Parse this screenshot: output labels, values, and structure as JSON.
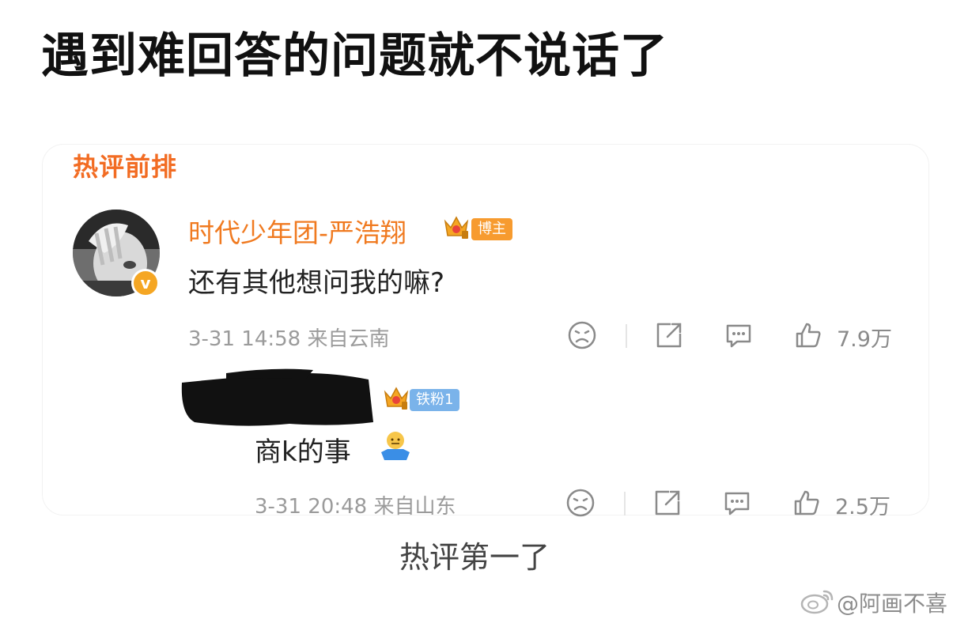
{
  "headline": "遇到难回答的问题就不说话了",
  "section_title": "热评前排",
  "comment": {
    "username": "时代少年团-严浩翔",
    "badge": "博主",
    "text": "还有其他想问我的嘛?",
    "timestamp": "3-31 14:58 来自云南",
    "likes": "7.9万",
    "verified_mark": "v"
  },
  "reply": {
    "badge": "铁粉1",
    "text": "商k的事",
    "timestamp": "3-31 20:48 来自山东",
    "likes": "2.5万"
  },
  "caption": "热评第一了",
  "watermark": "@阿画不喜",
  "colors": {
    "accent_orange": "#f26c23",
    "username_orange": "#f07a20",
    "blogger_badge": "#f79b2f",
    "fan_badge": "#7ab3ea",
    "meta_gray": "#9b9b9b"
  }
}
